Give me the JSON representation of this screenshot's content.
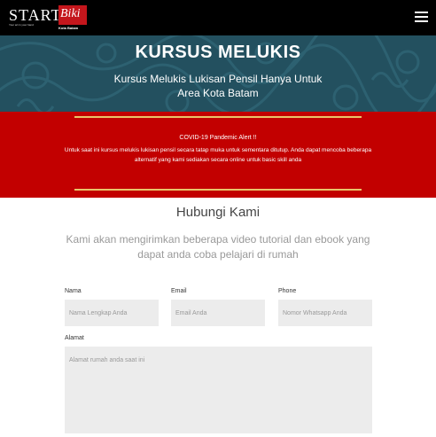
{
  "header": {
    "logo_start": "START",
    "logo_biki": "Biki",
    "logo_tagline": "Your art in your hand",
    "logo_city": "Kota Batam",
    "menu_icon": "hamburger-menu-icon"
  },
  "hero": {
    "title": "KURSUS MELUKIS",
    "subtitle": "Kursus Melukis Lukisan Pensil Hanya Untuk Area Kota Batam"
  },
  "alert": {
    "title": "COVID-19 Pandemic Alert !!",
    "body": "Untuk saat ini kursus melukis lukisan pensil secara tatap muka untuk sementara ditutup. Anda dapat mencoba beberapa alternatif yang kami sediakan secara online untuk basic skill anda"
  },
  "contact": {
    "title": "Hubungi Kami",
    "subtitle": "Kami akan mengirimkan beberapa video tutorial dan ebook yang dapat anda coba pelajari di rumah"
  },
  "form": {
    "name_label": "Nama",
    "name_placeholder": "Nama Lengkap Anda",
    "email_label": "Email",
    "email_placeholder": "Email Anda",
    "phone_label": "Phone",
    "phone_placeholder": "Nomor Whatsapp Anda",
    "address_label": "Alamat",
    "address_placeholder": "Alamat rumah anda saat ini"
  },
  "colors": {
    "topbar": "#000000",
    "hero": "#23505f",
    "alert": "#c20000",
    "alert_line": "#e9c46a",
    "input_bg": "#ececec"
  }
}
